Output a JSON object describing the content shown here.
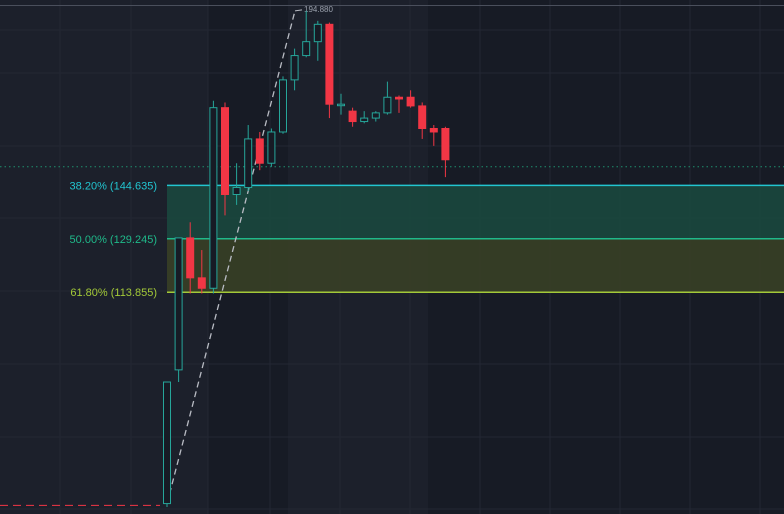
{
  "chart_data": {
    "type": "candlestick",
    "title": "",
    "xlabel": "",
    "ylabel": "",
    "ylim": [
      50,
      198
    ],
    "grid": true,
    "colors": {
      "up": "#26a69a",
      "down": "#f23645",
      "background": "#171b25",
      "grid": "#232733",
      "session_shade": "#1c202b",
      "level_382": "#22c5d0",
      "level_500": "#1fb98a",
      "level_618": "#a3c938",
      "zone_upper": "#1a4a40",
      "zone_lower": "#3a4226",
      "trend_line": "#b9bcc4",
      "current_price_line": "#1f8f6e"
    },
    "pre_move_price": 52.5,
    "current_price": 150,
    "fibonacci": {
      "levels": [
        {
          "ratio": 0.382,
          "label": "38.20% (144.635)",
          "price": 144.635
        },
        {
          "ratio": 0.5,
          "label": "50.00% (129.245)",
          "price": 129.245
        },
        {
          "ratio": 0.618,
          "label": "61.80% (113.855)",
          "price": 113.855
        }
      ],
      "swing_low": 53.0,
      "swing_high": 194.88,
      "swing_high_label": "194.880"
    },
    "candles": [
      {
        "o": 53.0,
        "h": 88.0,
        "l": 52.0,
        "c": 88.0
      },
      {
        "o": 91.5,
        "h": 129.5,
        "l": 88.0,
        "c": 129.5
      },
      {
        "o": 129.5,
        "h": 134.0,
        "l": 113.5,
        "c": 118.0
      },
      {
        "o": 118.0,
        "h": 126.0,
        "l": 113.5,
        "c": 115.0
      },
      {
        "o": 115.0,
        "h": 169.0,
        "l": 113.5,
        "c": 167.0
      },
      {
        "o": 167.0,
        "h": 168.5,
        "l": 136.0,
        "c": 142.0
      },
      {
        "o": 142.0,
        "h": 151.0,
        "l": 139.0,
        "c": 144.0
      },
      {
        "o": 144.0,
        "h": 162.0,
        "l": 143.0,
        "c": 158.0
      },
      {
        "o": 158.0,
        "h": 160.0,
        "l": 149.0,
        "c": 151.0
      },
      {
        "o": 151.0,
        "h": 161.0,
        "l": 150.0,
        "c": 160.0
      },
      {
        "o": 160.0,
        "h": 176.0,
        "l": 159.5,
        "c": 175.0
      },
      {
        "o": 175.0,
        "h": 184.0,
        "l": 172.0,
        "c": 182.0
      },
      {
        "o": 182.0,
        "h": 194.88,
        "l": 181.5,
        "c": 186.0
      },
      {
        "o": 186.0,
        "h": 192.0,
        "l": 180.5,
        "c": 191.0
      },
      {
        "o": 191.0,
        "h": 191.5,
        "l": 164.0,
        "c": 168.0
      },
      {
        "o": 168.0,
        "h": 171.0,
        "l": 165.0,
        "c": 168.0
      },
      {
        "o": 166.0,
        "h": 167.0,
        "l": 161.5,
        "c": 163.0
      },
      {
        "o": 163.0,
        "h": 166.0,
        "l": 162.5,
        "c": 164.0
      },
      {
        "o": 164.0,
        "h": 166.0,
        "l": 163.0,
        "c": 165.5
      },
      {
        "o": 165.5,
        "h": 174.5,
        "l": 165.0,
        "c": 170.0
      },
      {
        "o": 170.0,
        "h": 170.5,
        "l": 165.5,
        "c": 169.5
      },
      {
        "o": 170.0,
        "h": 172.0,
        "l": 167.0,
        "c": 167.5
      },
      {
        "o": 167.5,
        "h": 168.5,
        "l": 158.0,
        "c": 161.0
      },
      {
        "o": 161.0,
        "h": 162.0,
        "l": 156.0,
        "c": 160.0
      },
      {
        "o": 161.0,
        "h": 161.5,
        "l": 147.0,
        "c": 152.0
      }
    ]
  }
}
